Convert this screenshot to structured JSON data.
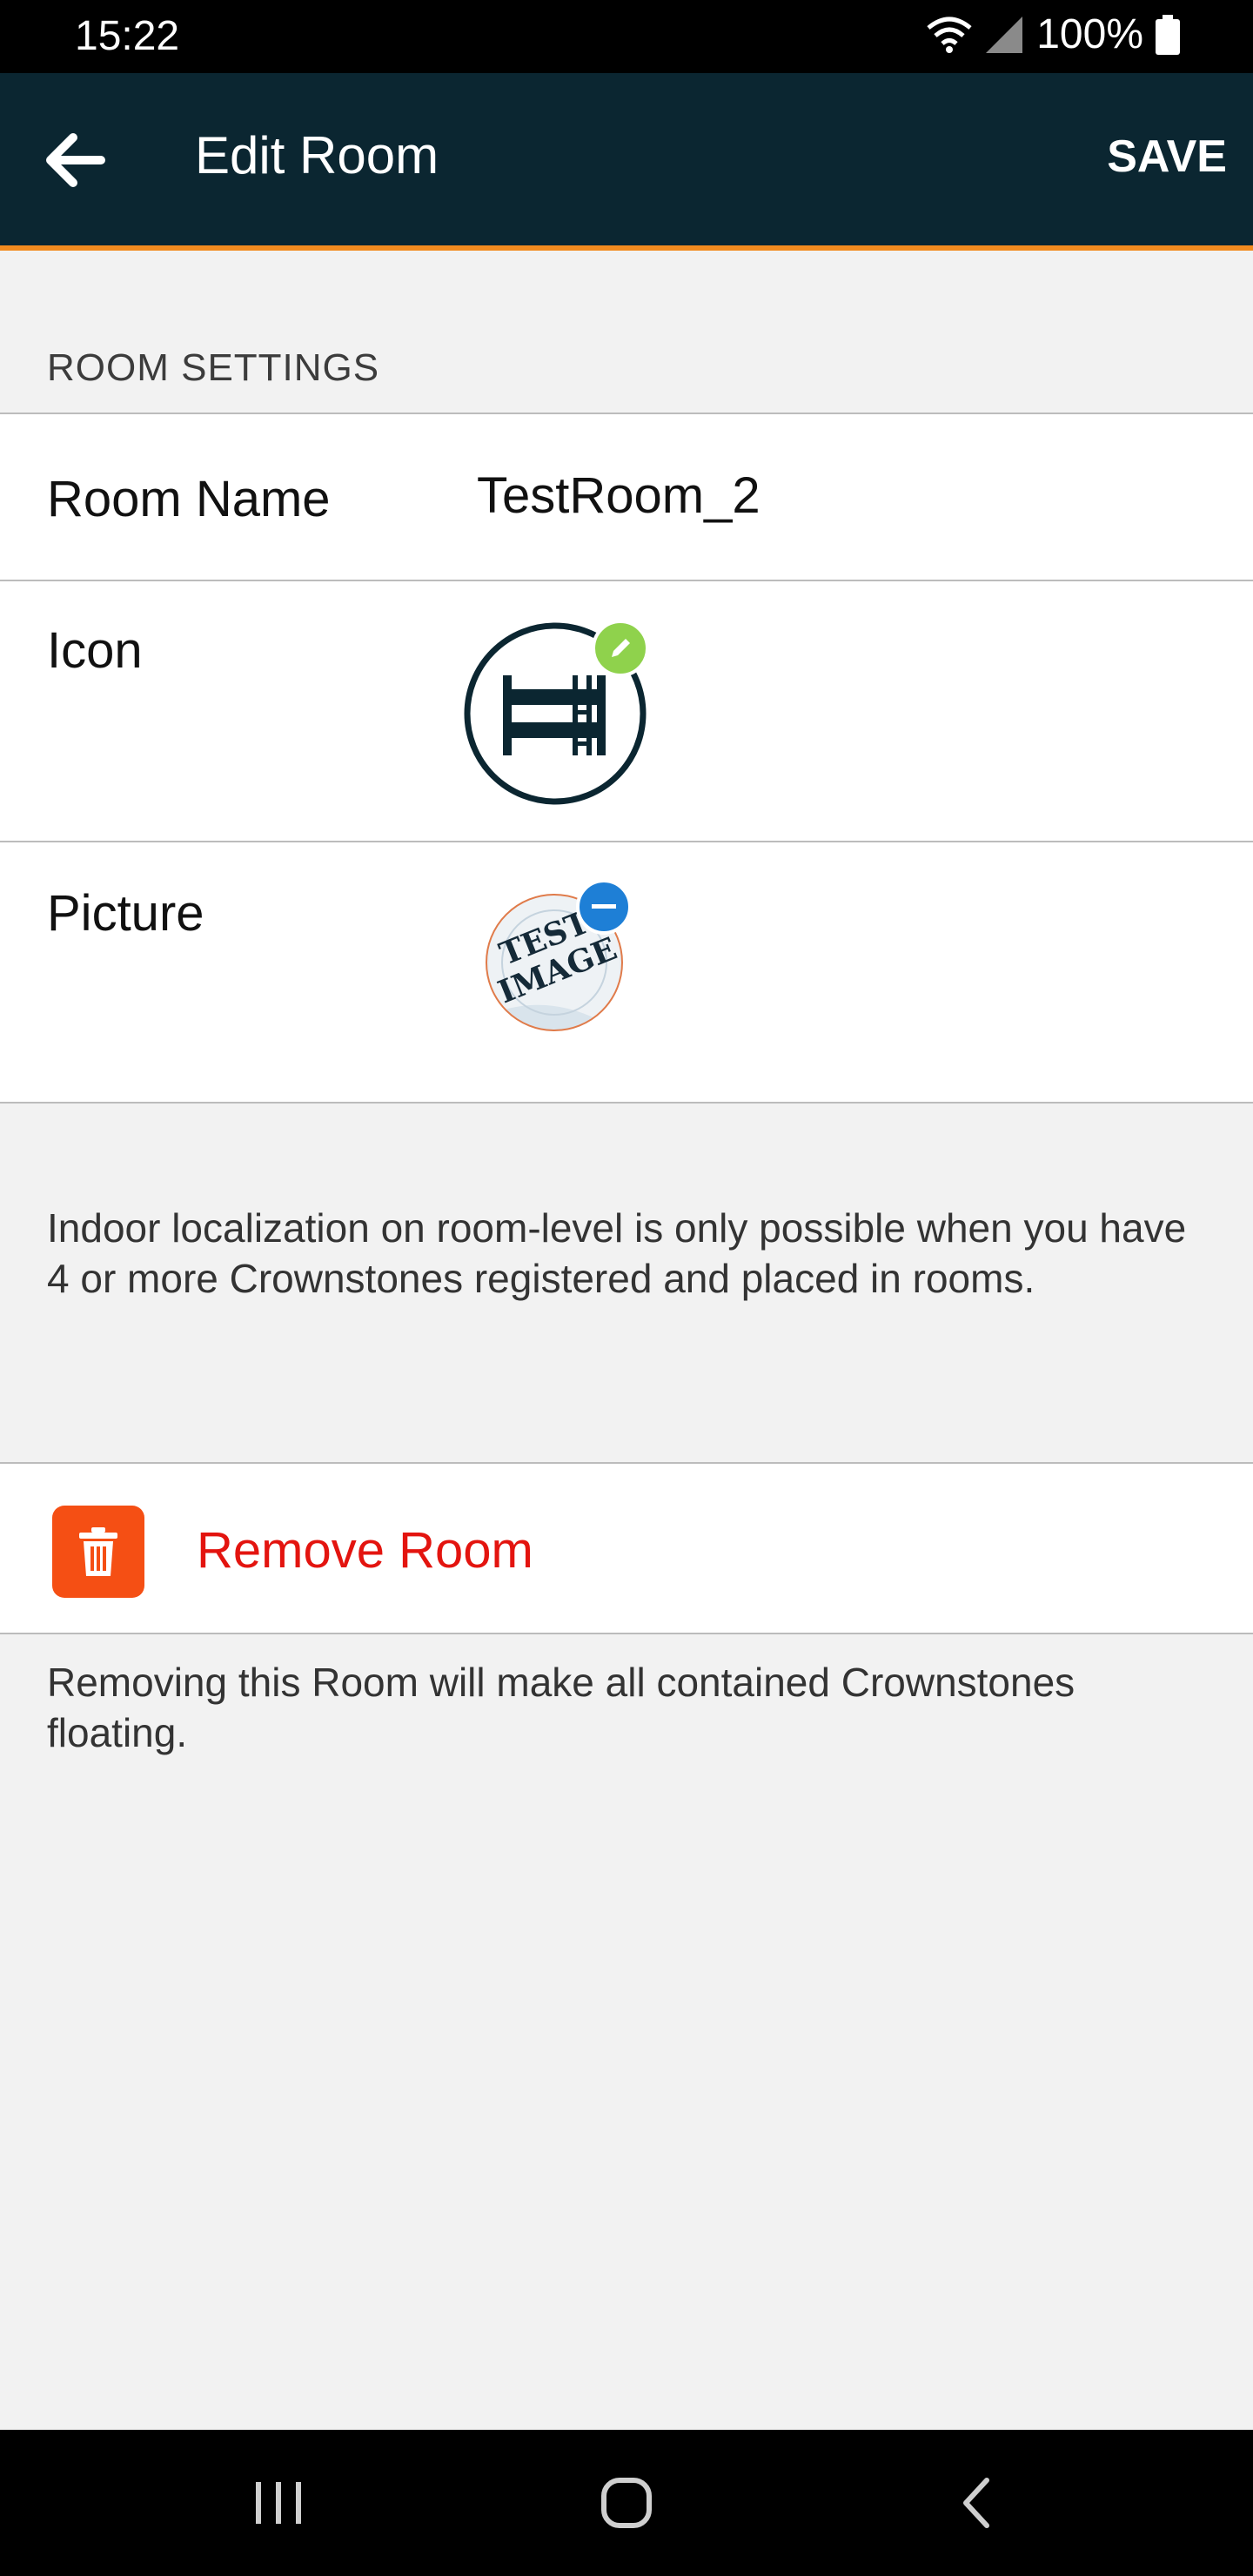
{
  "status_bar": {
    "time": "15:22",
    "battery": "100%"
  },
  "app_bar": {
    "back_icon": "arrow-left-icon",
    "title": "Edit Room",
    "save_label": "SAVE"
  },
  "room_settings": {
    "section_title": "ROOM SETTINGS",
    "name_label": "Room Name",
    "name_value": "TestRoom_2",
    "icon_label": "Icon",
    "icon_name": "bunk-bed-icon",
    "picture_label": "Picture",
    "picture_text_line1": "TEST",
    "picture_text_line2": "IMAGE"
  },
  "info_text": "Indoor localization on room-level is only possible when you have 4 or more Crownstones registered and placed in rooms.",
  "remove": {
    "label": "Remove Room",
    "description": "Removing this Room will make all contained Crownstones floating."
  },
  "colors": {
    "app_bar": "#0b2631",
    "accent": "#f28b1f",
    "destructive": "#e3140f",
    "edit_badge": "#8fd24c",
    "remove_badge": "#1e7fd6"
  }
}
